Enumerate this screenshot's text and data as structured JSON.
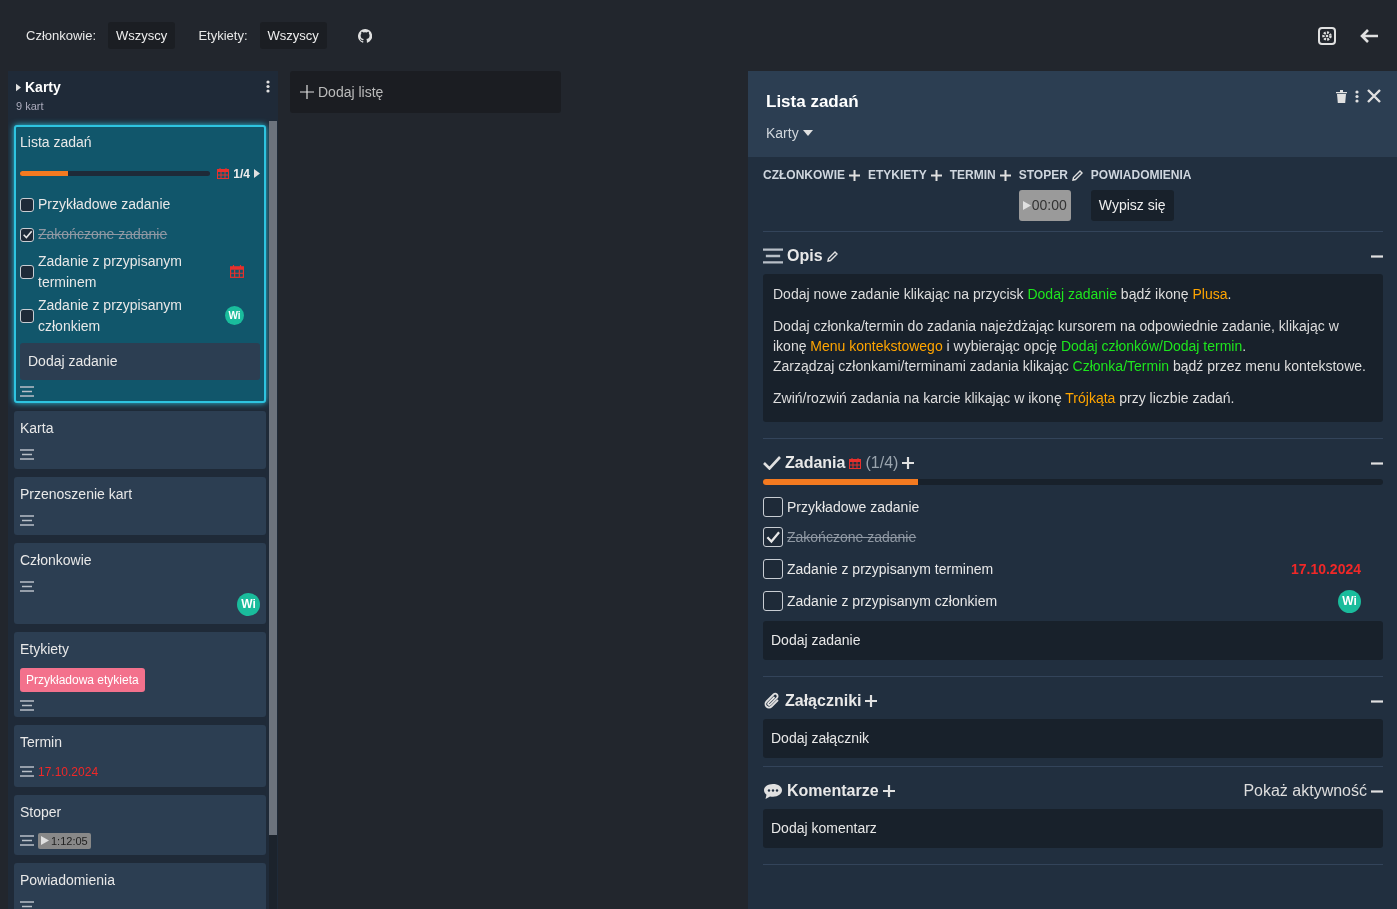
{
  "filters": [
    {
      "label": "Członkowie:",
      "value": "Wszyscy"
    },
    {
      "label": "Etykiety:",
      "value": "Wszyscy"
    }
  ],
  "list": {
    "title": "Karty",
    "count": "9 kart",
    "cards": [
      {
        "kind": "tasks",
        "title": "Lista zadań",
        "selected": true,
        "level": 0.25,
        "counter": "1/4",
        "tasks": [
          {
            "kind": "plain",
            "text": "Przykładowe zadanie",
            "checked": false
          },
          {
            "kind": "plain",
            "text": "Zakończone zadanie",
            "checked": true
          },
          {
            "kind": "due",
            "text": "Zadanie z przypisanym terminem",
            "checked": false
          },
          {
            "kind": "member",
            "text": "Zadanie z przypisanym członkiem",
            "checked": false,
            "avatar": "Wi"
          }
        ],
        "add_task": "Dodaj zadanie"
      },
      {
        "kind": "plain",
        "title": "Karta",
        "selected": false
      },
      {
        "kind": "plain",
        "title": "Przenoszenie kart",
        "selected": false
      },
      {
        "kind": "members",
        "title": "Członkowie",
        "selected": false,
        "avatar": "Wi"
      },
      {
        "kind": "labels",
        "title": "Etykiety",
        "selected": false,
        "labels": [
          {
            "text": "Przykładowa etykieta",
            "color": "#f3718c"
          }
        ]
      },
      {
        "kind": "due",
        "title": "Termin",
        "selected": false,
        "due": "17.10.2024"
      },
      {
        "kind": "timer",
        "title": "Stoper",
        "selected": false,
        "timer": "1:12:05"
      },
      {
        "kind": "plain",
        "title": "Powiadomienia",
        "selected": false
      }
    ]
  },
  "add_list": "Dodaj listę",
  "detail": {
    "title": "Lista zadań",
    "list_name": "Karty",
    "actions": [
      {
        "label": "CZŁONKOWIE",
        "kind": "add"
      },
      {
        "label": "ETYKIETY",
        "kind": "add"
      },
      {
        "label": "TERMIN",
        "kind": "add"
      },
      {
        "label": "STOPER",
        "kind": "edit",
        "control": {
          "kind": "timer",
          "text": "00:00"
        }
      },
      {
        "label": "POWIADOMIENIA",
        "kind": "plain",
        "control": {
          "kind": "button",
          "text": "Wypisz się"
        }
      }
    ],
    "description": {
      "heading": "Opis",
      "paragraphs": [
        {
          "lines": [
            [
              {
                "kind": "text",
                "text": "Dodaj nowe zadanie klikając na przycisk "
              },
              {
                "kind": "button",
                "text": "Dodaj zadanie"
              },
              {
                "kind": "text",
                "text": " bądź ikonę "
              },
              {
                "kind": "icon",
                "text": "Plusa"
              },
              {
                "kind": "text",
                "text": "."
              }
            ]
          ]
        },
        {
          "lines": [
            [
              {
                "kind": "text",
                "text": "Dodaj członka/termin do zadania najeżdżając kursorem na odpowiednie zadanie, klikając w ikonę "
              },
              {
                "kind": "icon",
                "text": "Menu kontekstowego"
              },
              {
                "kind": "text",
                "text": " i wybierając opcję "
              },
              {
                "kind": "button",
                "text": "Dodaj członków/Dodaj termin"
              },
              {
                "kind": "text",
                "text": "."
              }
            ],
            [
              {
                "kind": "text",
                "text": "Zarządzaj członkami/terminami zadania klikając "
              },
              {
                "kind": "button",
                "text": "Członka/Termin"
              },
              {
                "kind": "text",
                "text": " bądź przez menu kontekstowe."
              }
            ]
          ]
        },
        {
          "lines": [
            [
              {
                "kind": "text",
                "text": "Zwiń/rozwiń zadania na karcie klikając w ikonę "
              },
              {
                "kind": "icon",
                "text": "Trójkąta"
              },
              {
                "kind": "text",
                "text": " przy liczbie zadań."
              }
            ]
          ]
        }
      ]
    },
    "tasks": {
      "heading": "Zadania",
      "counter": "(1/4)",
      "level": 0.25,
      "items": [
        {
          "text": "Przykładowe zadanie",
          "checked": false
        },
        {
          "text": "Zakończone zadanie",
          "checked": true
        },
        {
          "text": "Zadanie z przypisanym terminem",
          "checked": false,
          "due": "17.10.2024"
        },
        {
          "text": "Zadanie z przypisanym członkiem",
          "checked": false,
          "avatar": "Wi"
        }
      ],
      "add": "Dodaj zadanie"
    },
    "attachments": {
      "heading": "Załączniki",
      "add": "Dodaj załącznik"
    },
    "comments": {
      "heading": "Komentarze",
      "activity": "Pokaż aktywność",
      "add": "Dodaj komentarz"
    }
  }
}
